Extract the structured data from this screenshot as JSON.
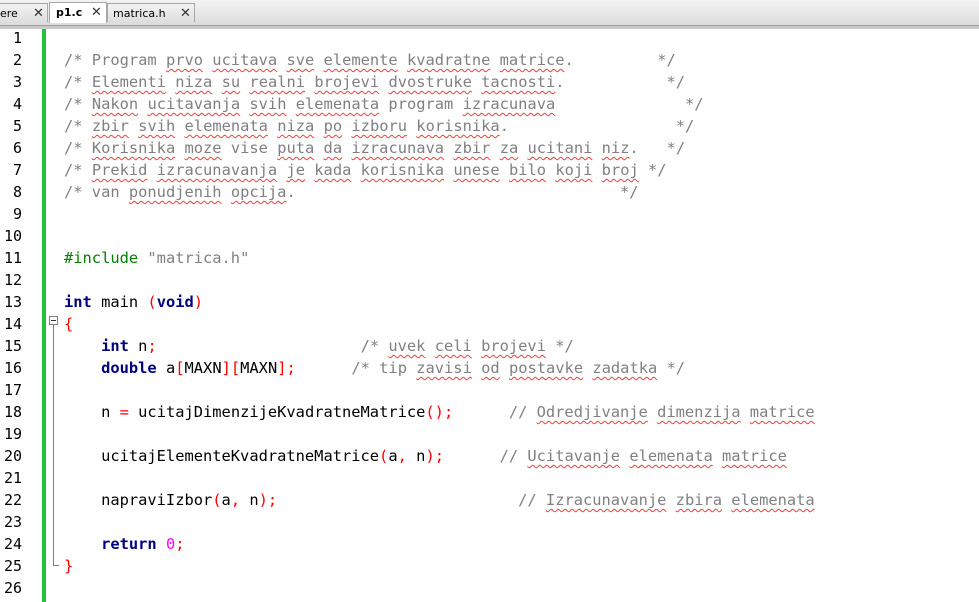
{
  "tabs": [
    {
      "label": "ere",
      "active": false
    },
    {
      "label": "p1.c",
      "active": true
    },
    {
      "label": "matrica.h",
      "active": false
    }
  ],
  "line_numbers": [
    "1",
    "2",
    "3",
    "4",
    "5",
    "6",
    "7",
    "8",
    "9",
    "10",
    "11",
    "12",
    "13",
    "14",
    "15",
    "16",
    "17",
    "18",
    "19",
    "20",
    "21",
    "22",
    "23",
    "24",
    "25",
    "26"
  ],
  "code": {
    "l2": [
      "/* Program ",
      "prvo",
      " ",
      "ucitava",
      " ",
      "sve",
      " ",
      "elemente",
      " ",
      "kvadratne",
      " ",
      "matrice",
      ".         */"
    ],
    "l3": [
      "/* ",
      "Elementi",
      " ",
      "niza",
      " ",
      "su",
      " ",
      "realni",
      " ",
      "brojevi",
      " ",
      "dvostruke",
      " ",
      "tacnosti",
      ".           */"
    ],
    "l4": [
      "/* ",
      "Nakon",
      " ",
      "ucitavanja",
      " ",
      "svih",
      " ",
      "elemenata",
      " program ",
      "izracunava",
      "              */"
    ],
    "l5": [
      "/* ",
      "zbir",
      " ",
      "svih",
      " ",
      "elemenata",
      " ",
      "niza",
      " ",
      "po",
      " ",
      "izboru",
      " ",
      "korisnika",
      ".                  */"
    ],
    "l6": [
      "/* ",
      "Korisnika",
      " ",
      "moze",
      " vise ",
      "puta",
      " ",
      "da",
      " ",
      "izracunava",
      " ",
      "zbir",
      " ",
      "za",
      " ",
      "ucitani",
      " ",
      "niz",
      ".   */"
    ],
    "l7": [
      "/* ",
      "Prekid",
      " ",
      "izracunavanja",
      " ",
      "je",
      " ",
      "kada",
      " ",
      "korisnika",
      " ",
      "unese",
      " ",
      "bilo",
      " ",
      "koji",
      " ",
      "broj",
      " */"
    ],
    "l8": [
      "/* van ",
      "ponudjenih",
      " ",
      "opcija",
      ".                                   */"
    ],
    "l11": [
      "#include ",
      "\"matrica.h\""
    ],
    "l13": [
      "int",
      " main ",
      "(",
      "void",
      ")"
    ],
    "l14": [
      "{"
    ],
    "l15": [
      "    ",
      "int",
      " n",
      ";",
      "                      /* ",
      "uvek",
      " ",
      "celi",
      " ",
      "brojevi",
      " */"
    ],
    "l16": [
      "    ",
      "double",
      " a",
      "[",
      "MAXN",
      "][",
      "MAXN",
      "];",
      "      /* tip ",
      "zavisi",
      " ",
      "od",
      " ",
      "postavke",
      " ",
      "zadatka",
      " */"
    ],
    "l18": [
      "    n ",
      "=",
      " ucitajDimenzijeKvadratneMatrice",
      "();",
      "      // ",
      "Odredjivanje",
      " ",
      "dimenzija",
      " ",
      "matrice"
    ],
    "l20": [
      "    ucitajElementeKvadratneMatrice",
      "(",
      "a",
      ",",
      " n",
      ");",
      "      // ",
      "Ucitavanje",
      " ",
      "elemenata",
      " ",
      "matrice"
    ],
    "l22": [
      "    napraviIzbor",
      "(",
      "a",
      ",",
      " n",
      ");",
      "                          // ",
      "Izracunavanje",
      " ",
      "zbira",
      " ",
      "elemenata"
    ],
    "l24": [
      "    ",
      "return",
      " ",
      "0",
      ";"
    ],
    "l25": [
      "}"
    ]
  },
  "colors": {
    "keyword": "#000080",
    "comment": "#808080",
    "preprocessor": "#008000",
    "operator": "#ff0000",
    "number": "#ff00ff",
    "change_bar": "#21c33b",
    "spellcheck": "#ff3a3a"
  }
}
